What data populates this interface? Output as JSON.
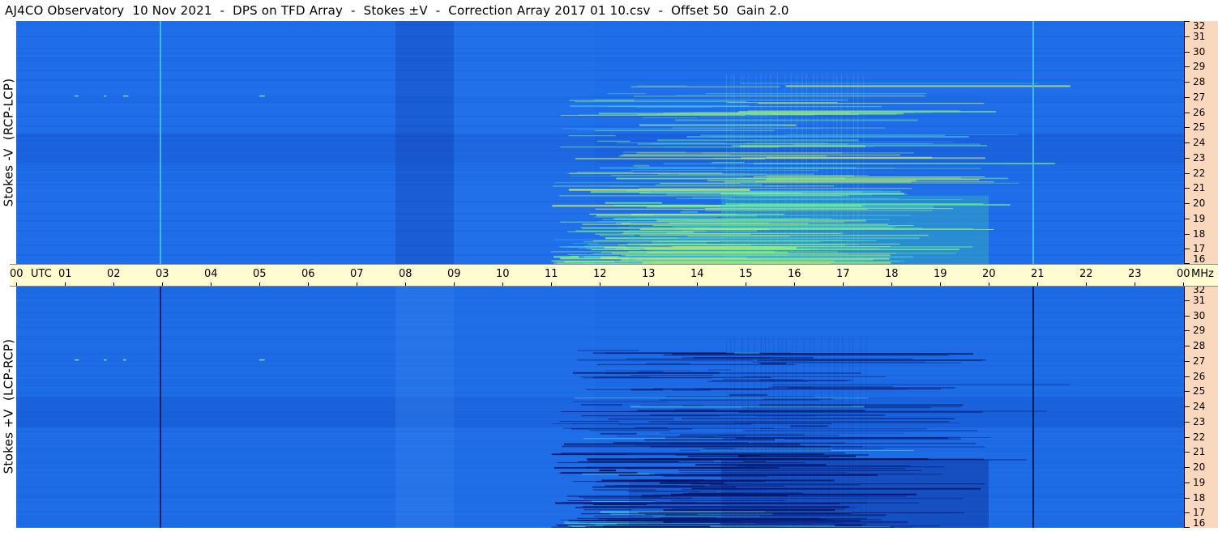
{
  "title": "AJ4CO Observatory  10 Nov 2021  -  DPS on TFD Array  -  Stokes ±V  -  Correction Array 2017 01 10.csv  -  Offset 50  Gain 2.0",
  "colors": {
    "background_top": "#1f6ee9",
    "background_bottom": "#1e6be6",
    "emission_bright": "#7cf08a",
    "emission_yellow": "#d9f25a",
    "emission_dark": "#03105a",
    "mhz_scale_bg": "#f9d8bd",
    "time_axis_bg": "#fffccf"
  },
  "chart_data": [
    {
      "type": "heatmap",
      "name": "Stokes -V (RCP-LCP)",
      "ylabel": "Stokes -V  (RCP-LCP)",
      "x": [
        "00",
        "01",
        "02",
        "03",
        "04",
        "05",
        "06",
        "07",
        "08",
        "09",
        "10",
        "11",
        "12",
        "13",
        "14",
        "15",
        "16",
        "17",
        "18",
        "19",
        "20",
        "21",
        "22",
        "23",
        "00"
      ],
      "xlabel": "UTC",
      "y_mhz": [
        32,
        31,
        30,
        29,
        28,
        27,
        26,
        25,
        24,
        23,
        22,
        21,
        20,
        19,
        18,
        17,
        16
      ],
      "ylabel_unit": "MHz",
      "xlim_hours": [
        0,
        24
      ],
      "ylim_mhz": [
        16,
        32
      ],
      "emission_hours": [
        11.0,
        24.0
      ],
      "peak_emission_hours": [
        14.5,
        20.0
      ],
      "vertical_line_hours": [
        2.95,
        20.9
      ]
    },
    {
      "type": "heatmap",
      "name": "Stokes +V (LCP-RCP)",
      "ylabel": "Stokes +V  (LCP-RCP)",
      "x": [
        "00",
        "01",
        "02",
        "03",
        "04",
        "05",
        "06",
        "07",
        "08",
        "09",
        "10",
        "11",
        "12",
        "13",
        "14",
        "15",
        "16",
        "17",
        "18",
        "19",
        "20",
        "21",
        "22",
        "23",
        "00"
      ],
      "xlabel": "UTC",
      "y_mhz": [
        32,
        31,
        30,
        29,
        28,
        27,
        26,
        25,
        24,
        23,
        22,
        21,
        20,
        19,
        18,
        17,
        16
      ],
      "ylabel_unit": "MHz",
      "xlim_hours": [
        0,
        24
      ],
      "ylim_mhz": [
        16,
        32
      ],
      "emission_hours": [
        11.0,
        24.0
      ],
      "peak_emission_hours": [
        14.5,
        20.0
      ],
      "vertical_line_hours": [
        2.95,
        20.9
      ]
    }
  ],
  "axis": {
    "utc_label": "UTC",
    "mhz_label": "MHz"
  }
}
